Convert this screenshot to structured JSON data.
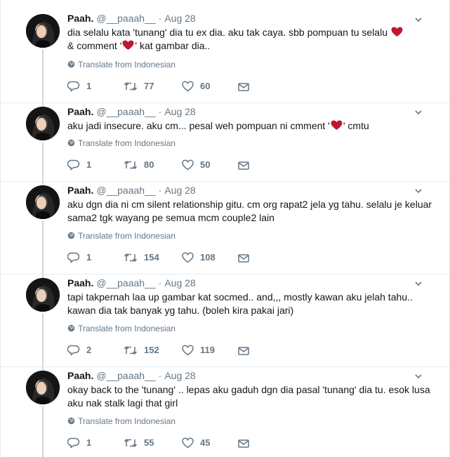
{
  "author": {
    "name": "Paah.",
    "handle": "@__paaah__",
    "separator": "·"
  },
  "translate_label": "Translate from Indonesian",
  "colors": {
    "thread_line": "#ccd6dd",
    "heart_emoji": "#be1931",
    "muted": "#657786"
  },
  "icons": {
    "reply": "reply-icon",
    "retweet": "retweet-icon",
    "like": "heart-icon",
    "dm": "envelope-icon",
    "menu": "chevron-down-icon",
    "translate": "globe-icon"
  },
  "tweets": [
    {
      "date": "Aug 28",
      "text_parts": [
        "dia selalu kata 'tunang' dia tu ex dia. aku tak caya. sbb pompuan tu selalu ",
        "& comment '",
        "' kat gambar dia.."
      ],
      "replies": "1",
      "retweets": "77",
      "likes": "60"
    },
    {
      "date": "Aug 28",
      "text_parts": [
        "aku jadi insecure. aku cm... pesal weh pompuan ni cmment '",
        "' cmtu"
      ],
      "replies": "1",
      "retweets": "80",
      "likes": "50"
    },
    {
      "date": "Aug 28",
      "text_parts": [
        "aku dgn dia ni cm silent relationship gitu. cm org rapat2 jela yg tahu. selalu je keluar sama2 tgk wayang pe semua mcm couple2 lain"
      ],
      "replies": "1",
      "retweets": "154",
      "likes": "108"
    },
    {
      "date": "Aug 28",
      "text_parts": [
        "tapi takpernah laa up gambar kat socmed.. and,,, mostly kawan aku jelah tahu.. kawan dia tak banyak yg tahu. (boleh kira pakai jari)"
      ],
      "replies": "2",
      "retweets": "152",
      "likes": "119"
    },
    {
      "date": "Aug 28",
      "text_parts": [
        "okay back to the 'tunang' .. lepas aku gaduh dgn dia pasal 'tunang' dia tu. esok lusa aku nak stalk lagi that girl"
      ],
      "replies": "1",
      "retweets": "55",
      "likes": "45"
    }
  ]
}
